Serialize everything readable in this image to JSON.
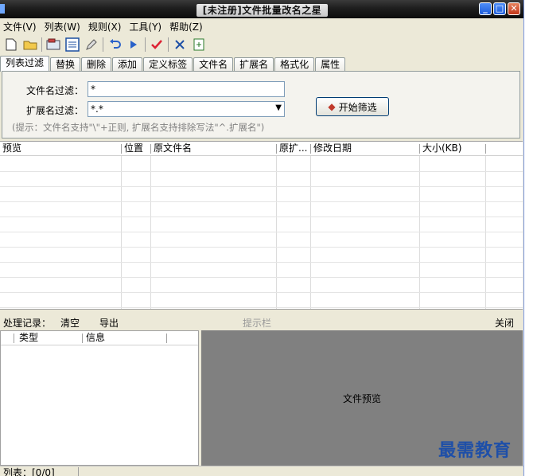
{
  "window": {
    "title": "[未注册]文件批量改名之星"
  },
  "menu": [
    "文件(V)",
    "列表(W)",
    "规则(X)",
    "工具(Y)",
    "帮助(Z)"
  ],
  "tabs": [
    "列表过滤",
    "替换",
    "删除",
    "添加",
    "定义标签",
    "文件名",
    "扩展名",
    "格式化",
    "属性"
  ],
  "filter": {
    "name_label": "文件名过滤：",
    "name_value": "*",
    "ext_label": "扩展名过滤：",
    "ext_value": "*.*",
    "start_button": "开始筛选",
    "hint": "(提示：文件名支持\"\\\"+正则, 扩展名支持排除写法\"^.扩展名\")"
  },
  "list": {
    "columns": [
      "预览",
      "位置",
      "原文件名",
      "原扩...",
      "修改日期",
      "大小(KB)"
    ]
  },
  "records": {
    "label": "处理记录：",
    "clear": "清空",
    "export": "导出",
    "hint_bar": "提示栏",
    "close": "关闭"
  },
  "log": {
    "columns": [
      "类型",
      "信息"
    ]
  },
  "preview": {
    "text": "文件预览"
  },
  "status": {
    "text": "列表：[0/0]"
  },
  "watermark": "最需教育"
}
